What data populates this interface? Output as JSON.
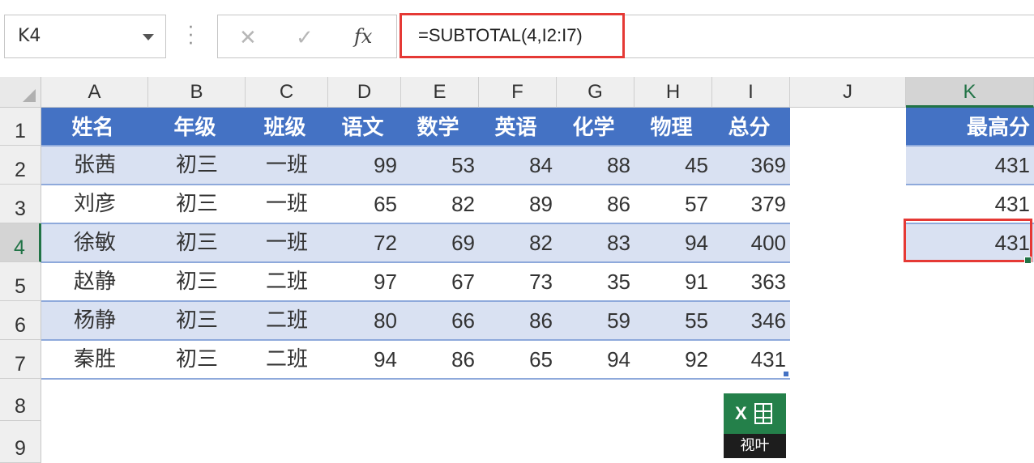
{
  "formula_bar": {
    "name_box": "K4",
    "cancel_icon": "✕",
    "enter_icon": "✓",
    "fx_label": "fx",
    "formula": "=SUBTOTAL(4,I2:I7)"
  },
  "columns": [
    "A",
    "B",
    "C",
    "D",
    "E",
    "F",
    "G",
    "H",
    "I",
    "J",
    "K"
  ],
  "rows": [
    "1",
    "2",
    "3",
    "4",
    "5",
    "6",
    "7",
    "8",
    "9"
  ],
  "table": {
    "headers": [
      "姓名",
      "年级",
      "班级",
      "语文",
      "数学",
      "英语",
      "化学",
      "物理",
      "总分"
    ],
    "rows": [
      [
        "张茜",
        "初三",
        "一班",
        "99",
        "53",
        "84",
        "88",
        "45",
        "369"
      ],
      [
        "刘彦",
        "初三",
        "一班",
        "65",
        "82",
        "89",
        "86",
        "57",
        "379"
      ],
      [
        "徐敏",
        "初三",
        "一班",
        "72",
        "69",
        "82",
        "83",
        "94",
        "400"
      ],
      [
        "赵静",
        "初三",
        "二班",
        "97",
        "67",
        "73",
        "35",
        "91",
        "363"
      ],
      [
        "杨静",
        "初三",
        "二班",
        "80",
        "66",
        "86",
        "59",
        "55",
        "346"
      ],
      [
        "秦胜",
        "初三",
        "二班",
        "94",
        "86",
        "65",
        "94",
        "92",
        "431"
      ]
    ]
  },
  "k_column": {
    "header": "最高分",
    "values": [
      "431",
      "431",
      "431"
    ]
  },
  "logo": {
    "mark": "X",
    "text": "视叶"
  },
  "colors": {
    "header_fill": "#4472c4",
    "band_fill": "#d9e1f2",
    "highlight_border": "#e53935",
    "excel_green": "#217346"
  }
}
